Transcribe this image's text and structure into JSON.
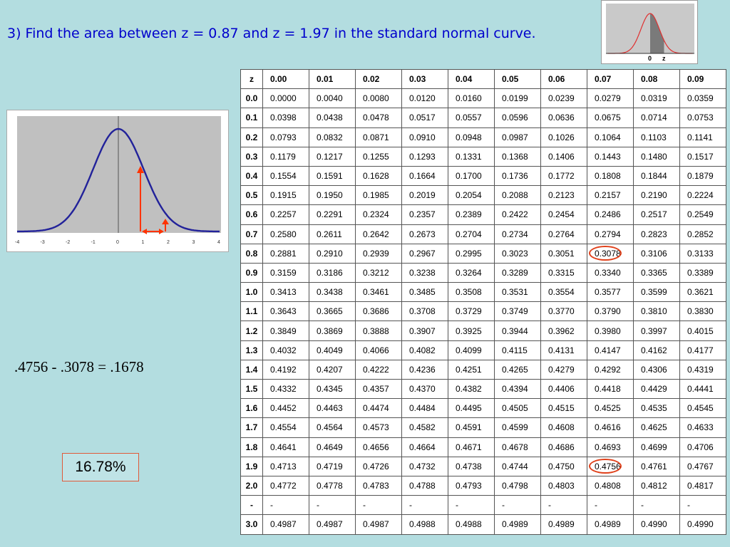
{
  "title": "3)  Find the area between z = 0.87 and z = 1.97 in the standard normal curve.",
  "thumbnail": {
    "labels": [
      "0",
      "z"
    ]
  },
  "graph": {
    "x_ticks": [
      "-4",
      "-3",
      "-2",
      "-1",
      "0",
      "1",
      "2",
      "3",
      "4"
    ],
    "z_low": 0.87,
    "z_high": 1.97
  },
  "equation": ".4756 - .3078 = .1678",
  "answer": "16.78%",
  "table": {
    "corner": "z",
    "columns": [
      "0.00",
      "0.01",
      "0.02",
      "0.03",
      "0.04",
      "0.05",
      "0.06",
      "0.07",
      "0.08",
      "0.09"
    ],
    "rows": [
      {
        "z": "0.0",
        "values": [
          "0.0000",
          "0.0040",
          "0.0080",
          "0.0120",
          "0.0160",
          "0.0199",
          "0.0239",
          "0.0279",
          "0.0319",
          "0.0359"
        ]
      },
      {
        "z": "0.1",
        "values": [
          "0.0398",
          "0.0438",
          "0.0478",
          "0.0517",
          "0.0557",
          "0.0596",
          "0.0636",
          "0.0675",
          "0.0714",
          "0.0753"
        ]
      },
      {
        "z": "0.2",
        "values": [
          "0.0793",
          "0.0832",
          "0.0871",
          "0.0910",
          "0.0948",
          "0.0987",
          "0.1026",
          "0.1064",
          "0.1103",
          "0.1141"
        ]
      },
      {
        "z": "0.3",
        "values": [
          "0.1179",
          "0.1217",
          "0.1255",
          "0.1293",
          "0.1331",
          "0.1368",
          "0.1406",
          "0.1443",
          "0.1480",
          "0.1517"
        ]
      },
      {
        "z": "0.4",
        "values": [
          "0.1554",
          "0.1591",
          "0.1628",
          "0.1664",
          "0.1700",
          "0.1736",
          "0.1772",
          "0.1808",
          "0.1844",
          "0.1879"
        ]
      },
      {
        "z": "0.5",
        "values": [
          "0.1915",
          "0.1950",
          "0.1985",
          "0.2019",
          "0.2054",
          "0.2088",
          "0.2123",
          "0.2157",
          "0.2190",
          "0.2224"
        ]
      },
      {
        "z": "0.6",
        "values": [
          "0.2257",
          "0.2291",
          "0.2324",
          "0.2357",
          "0.2389",
          "0.2422",
          "0.2454",
          "0.2486",
          "0.2517",
          "0.2549"
        ]
      },
      {
        "z": "0.7",
        "values": [
          "0.2580",
          "0.2611",
          "0.2642",
          "0.2673",
          "0.2704",
          "0.2734",
          "0.2764",
          "0.2794",
          "0.2823",
          "0.2852"
        ]
      },
      {
        "z": "0.8",
        "values": [
          "0.2881",
          "0.2910",
          "0.2939",
          "0.2967",
          "0.2995",
          "0.3023",
          "0.3051",
          "0.3078",
          "0.3106",
          "0.3133"
        ]
      },
      {
        "z": "0.9",
        "values": [
          "0.3159",
          "0.3186",
          "0.3212",
          "0.3238",
          "0.3264",
          "0.3289",
          "0.3315",
          "0.3340",
          "0.3365",
          "0.3389"
        ]
      },
      {
        "z": "1.0",
        "values": [
          "0.3413",
          "0.3438",
          "0.3461",
          "0.3485",
          "0.3508",
          "0.3531",
          "0.3554",
          "0.3577",
          "0.3599",
          "0.3621"
        ]
      },
      {
        "z": "1.1",
        "values": [
          "0.3643",
          "0.3665",
          "0.3686",
          "0.3708",
          "0.3729",
          "0.3749",
          "0.3770",
          "0.3790",
          "0.3810",
          "0.3830"
        ]
      },
      {
        "z": "1.2",
        "values": [
          "0.3849",
          "0.3869",
          "0.3888",
          "0.3907",
          "0.3925",
          "0.3944",
          "0.3962",
          "0.3980",
          "0.3997",
          "0.4015"
        ]
      },
      {
        "z": "1.3",
        "values": [
          "0.4032",
          "0.4049",
          "0.4066",
          "0.4082",
          "0.4099",
          "0.4115",
          "0.4131",
          "0.4147",
          "0.4162",
          "0.4177"
        ]
      },
      {
        "z": "1.4",
        "values": [
          "0.4192",
          "0.4207",
          "0.4222",
          "0.4236",
          "0.4251",
          "0.4265",
          "0.4279",
          "0.4292",
          "0.4306",
          "0.4319"
        ]
      },
      {
        "z": "1.5",
        "values": [
          "0.4332",
          "0.4345",
          "0.4357",
          "0.4370",
          "0.4382",
          "0.4394",
          "0.4406",
          "0.4418",
          "0.4429",
          "0.4441"
        ]
      },
      {
        "z": "1.6",
        "values": [
          "0.4452",
          "0.4463",
          "0.4474",
          "0.4484",
          "0.4495",
          "0.4505",
          "0.4515",
          "0.4525",
          "0.4535",
          "0.4545"
        ]
      },
      {
        "z": "1.7",
        "values": [
          "0.4554",
          "0.4564",
          "0.4573",
          "0.4582",
          "0.4591",
          "0.4599",
          "0.4608",
          "0.4616",
          "0.4625",
          "0.4633"
        ]
      },
      {
        "z": "1.8",
        "values": [
          "0.4641",
          "0.4649",
          "0.4656",
          "0.4664",
          "0.4671",
          "0.4678",
          "0.4686",
          "0.4693",
          "0.4699",
          "0.4706"
        ]
      },
      {
        "z": "1.9",
        "values": [
          "0.4713",
          "0.4719",
          "0.4726",
          "0.4732",
          "0.4738",
          "0.4744",
          "0.4750",
          "0.4756",
          "0.4761",
          "0.4767"
        ]
      },
      {
        "z": "2.0",
        "values": [
          "0.4772",
          "0.4778",
          "0.4783",
          "0.4788",
          "0.4793",
          "0.4798",
          "0.4803",
          "0.4808",
          "0.4812",
          "0.4817"
        ]
      },
      {
        "z": "-",
        "values": [
          "-",
          "-",
          "-",
          "-",
          "-",
          "-",
          "-",
          "-",
          "-",
          "-"
        ]
      },
      {
        "z": "3.0",
        "values": [
          "0.4987",
          "0.4987",
          "0.4987",
          "0.4988",
          "0.4988",
          "0.4989",
          "0.4989",
          "0.4989",
          "0.4990",
          "0.4990"
        ]
      }
    ],
    "highlighted": [
      {
        "row": "0.8",
        "column": "0.07"
      },
      {
        "row": "1.9",
        "column": "0.07"
      }
    ]
  },
  "colors": {
    "background": "#b3dde0",
    "title": "#0000cc",
    "curve": "#2a2aa0",
    "arrow": "#ff3300",
    "highlight": "#e0401a"
  }
}
